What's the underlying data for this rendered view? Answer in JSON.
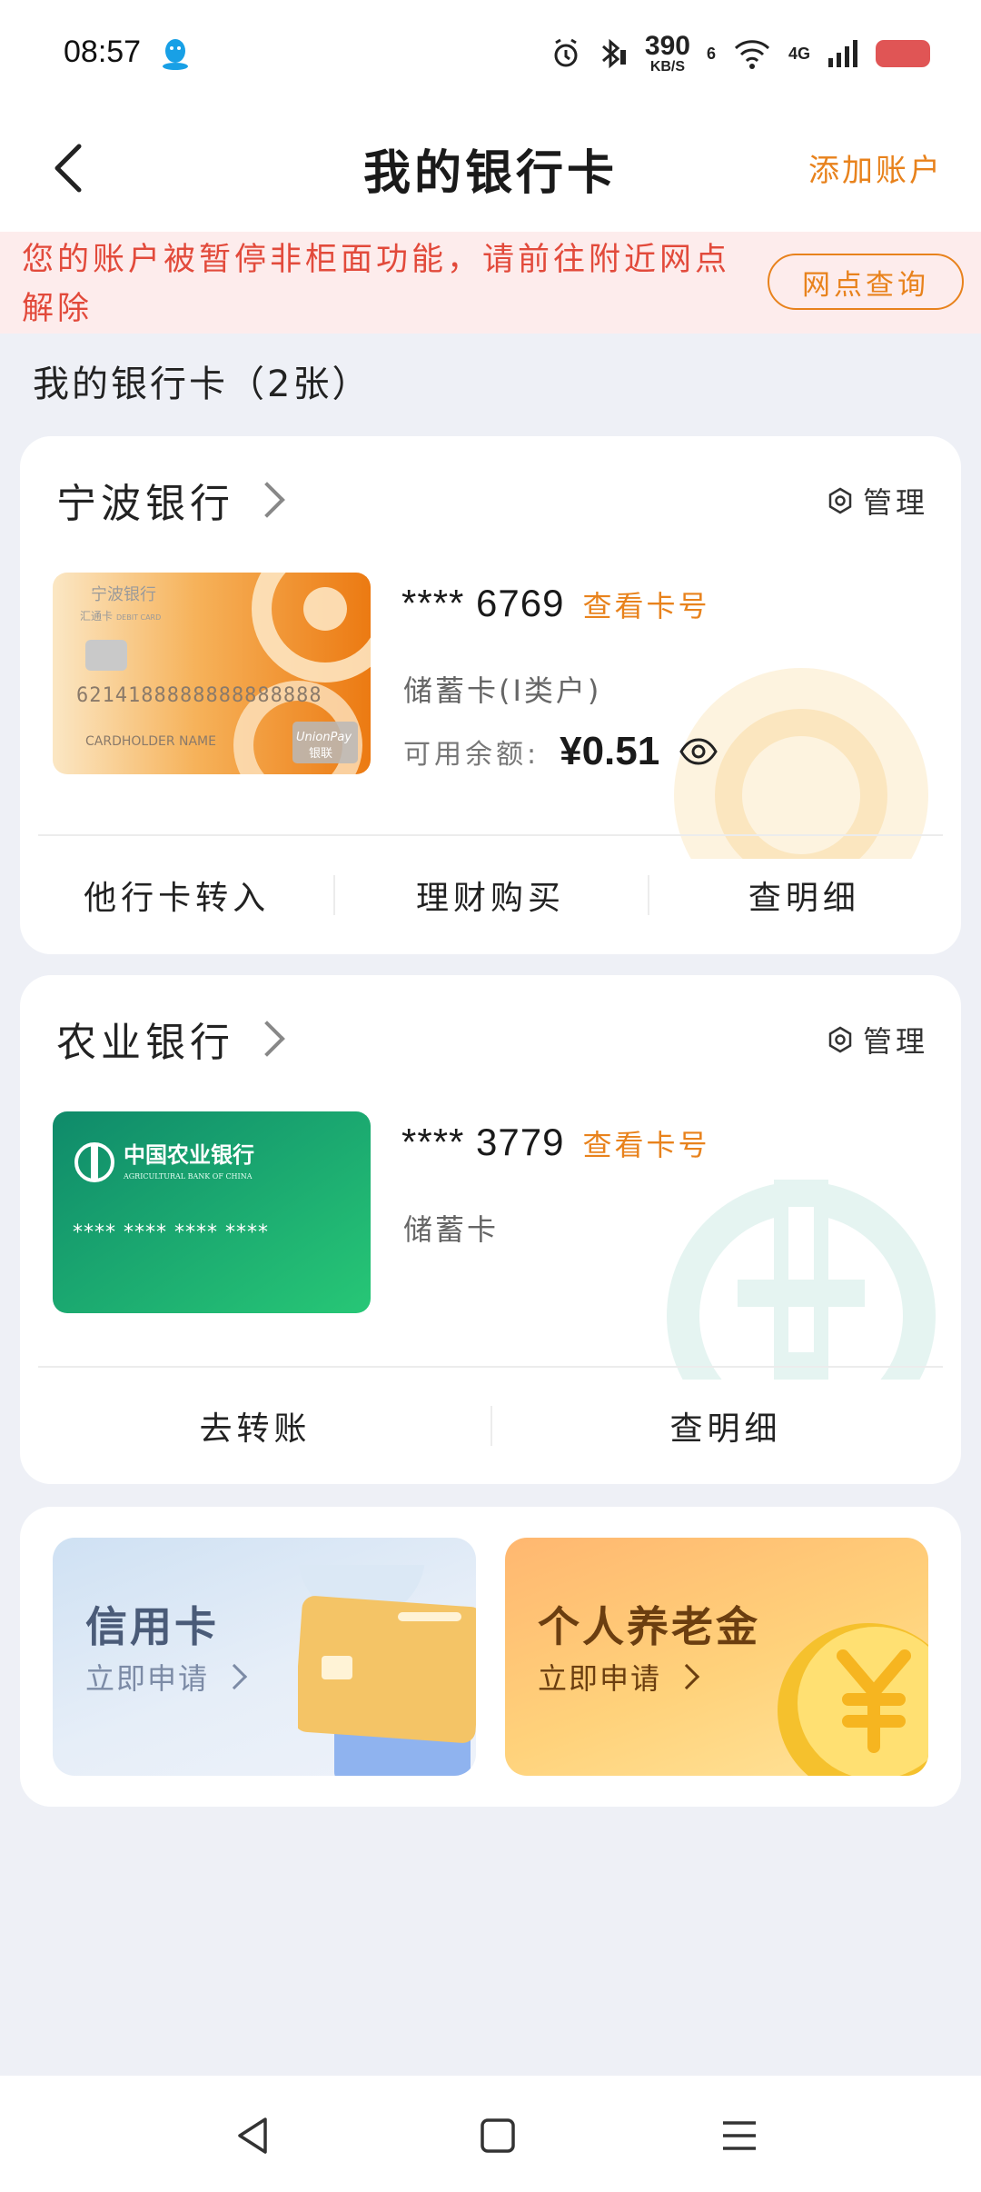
{
  "status_bar": {
    "time": "08:57",
    "net_speed": "390",
    "net_unit": "KB/S",
    "signal_label": "4G",
    "sim_index": "6",
    "icons": [
      "qq-icon",
      "alarm-icon",
      "bluetooth-icon",
      "wifi-icon",
      "signal-icon",
      "battery-icon"
    ]
  },
  "header": {
    "title": "我的银行卡",
    "add_account": "添加账户"
  },
  "notice": {
    "text": "您的账户被暂停非柜面功能，请前往附近网点解除",
    "button": "网点查询"
  },
  "section_title": "我的银行卡（2张）",
  "cards": [
    {
      "bank": "宁波银行",
      "manage": "管理",
      "masked_number": "**** 6769",
      "view_number": "查看卡号",
      "card_type": "储蓄卡(Ⅰ类户)",
      "balance_label": "可用余额:",
      "balance": "¥0.51",
      "card_art": {
        "bank_name": "宁波银行",
        "product": "汇通卡",
        "product_en": "DEBIT CARD",
        "number": "6214188888888888888",
        "holder": "CARDHOLDER NAME",
        "network": "UnionPay",
        "network_cn": "银联"
      },
      "actions": [
        "他行卡转入",
        "理财购买",
        "查明细"
      ]
    },
    {
      "bank": "农业银行",
      "manage": "管理",
      "masked_number": "**** 3779",
      "view_number": "查看卡号",
      "card_type": "储蓄卡",
      "card_art": {
        "bank_name": "中国农业银行",
        "bank_name_en": "AGRICULTURAL BANK OF CHINA",
        "number": "**** **** **** ****"
      },
      "actions": [
        "去转账",
        "查明细"
      ]
    }
  ],
  "promos": [
    {
      "title": "信用卡",
      "subtitle": "立即申请"
    },
    {
      "title": "个人养老金",
      "subtitle": "立即申请"
    }
  ],
  "colors": {
    "accent_orange": "#e8821c",
    "notice_red": "#e24a3b",
    "notice_bg": "#fdecec",
    "page_bg": "#eef0f6",
    "abc_green": "#1aa070"
  }
}
